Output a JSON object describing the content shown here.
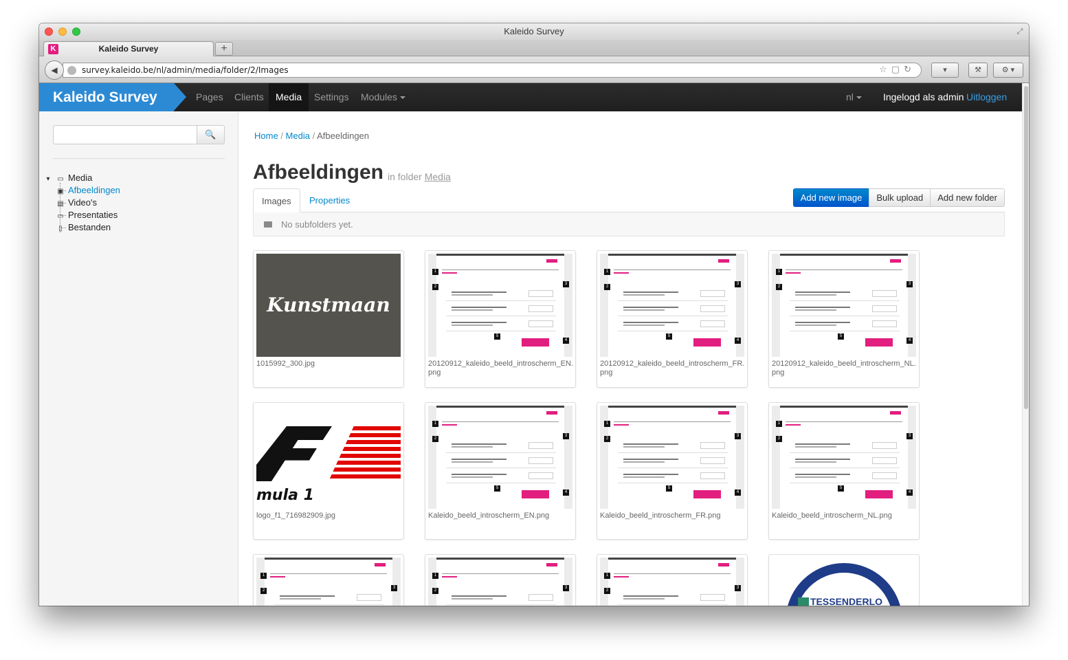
{
  "window": {
    "title": "Kaleido Survey"
  },
  "browser": {
    "tab_title": "Kaleido Survey",
    "favicon_letter": "K",
    "url": "survey.kaleido.be/nl/admin/media/folder/2/Images",
    "new_tab_label": "+"
  },
  "navbar": {
    "brand": "Kaleido Survey",
    "items": [
      "Pages",
      "Clients",
      "Media",
      "Settings",
      "Modules"
    ],
    "active": "Media",
    "language": "nl",
    "logged_in_text": "Ingelogd als admin",
    "logout_label": "Uitloggen"
  },
  "sidebar": {
    "search": {
      "placeholder": "",
      "value": ""
    },
    "tree": {
      "root": "Media",
      "children": [
        "Afbeeldingen",
        "Video's",
        "Presentaties",
        "Bestanden"
      ],
      "selected": "Afbeeldingen"
    }
  },
  "main": {
    "breadcrumb": [
      "Home",
      "Media",
      "Afbeeldingen"
    ],
    "title": "Afbeeldingen",
    "subtitle_prefix": "in folder",
    "subtitle_link": "Media",
    "tabs": [
      "Images",
      "Properties"
    ],
    "active_tab": "Images",
    "buttons": {
      "add_image": "Add new image",
      "bulk_upload": "Bulk upload",
      "add_folder": "Add new folder"
    },
    "subfolders_empty": "No subfolders yet.",
    "thumbnails": [
      {
        "caption": "1015992_300.jpg",
        "kind": "kunstmaan",
        "logo_text": "Kunstmaan"
      },
      {
        "caption": "20120912_kaleido_beeld_introscherm_EN.png",
        "kind": "screenshot"
      },
      {
        "caption": "20120912_kaleido_beeld_introscherm_FR.png",
        "kind": "screenshot"
      },
      {
        "caption": "20120912_kaleido_beeld_introscherm_NL.png",
        "kind": "screenshot"
      },
      {
        "caption": "logo_f1_716982909.jpg",
        "kind": "f1",
        "logo_text": "mula 1"
      },
      {
        "caption": "Kaleido_beeld_introscherm_EN.png",
        "kind": "screenshot"
      },
      {
        "caption": "Kaleido_beeld_introscherm_FR.png",
        "kind": "screenshot"
      },
      {
        "caption": "Kaleido_beeld_introscherm_NL.png",
        "kind": "screenshot"
      },
      {
        "caption": "",
        "kind": "screenshot"
      },
      {
        "caption": "",
        "kind": "screenshot"
      },
      {
        "caption": "",
        "kind": "screenshot"
      },
      {
        "caption": "",
        "kind": "tessenderlo",
        "logo_text": "TESSENDERLO"
      }
    ]
  },
  "colors": {
    "brand": "#2c8ad4",
    "accent_pink": "#e21e7f",
    "link": "#0088cc",
    "navbar": "#222222"
  }
}
